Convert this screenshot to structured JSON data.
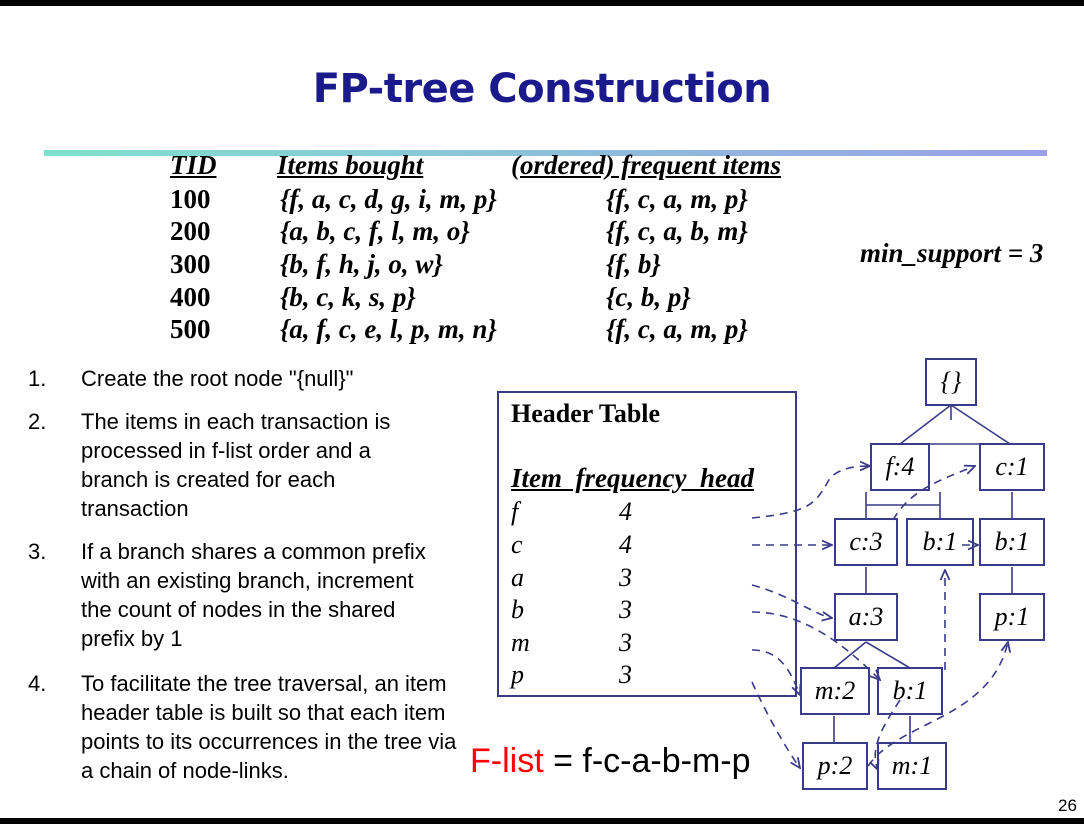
{
  "title": "FP-tree Construction",
  "table": {
    "headers": [
      "TID",
      "Items bought",
      "(ordered) frequent items"
    ],
    "rows": [
      {
        "tid": "100",
        "items": "{f, a, c, d, g, i, m, p}",
        "ordered": "{f, c, a, m, p}"
      },
      {
        "tid": "200",
        "items": "{a, b, c, f, l, m, o}",
        "ordered": "{f, c, a, b, m}"
      },
      {
        "tid": "300",
        "items": "{b, f, h, j, o, w}",
        "ordered": "{f, b}"
      },
      {
        "tid": "400",
        "items": "{b, c, k, s, p}",
        "ordered": "{c, b, p}"
      },
      {
        "tid": "500",
        "items": "{a, f, c, e, l, p, m, n}",
        "ordered": "{f, c, a, m, p}"
      }
    ]
  },
  "min_support": "min_support = 3",
  "steps": [
    {
      "num": "1.",
      "text": "Create the root node \"{null}\""
    },
    {
      "num": "2.",
      "text": "The items in each transaction is processed in f-list order and a branch is created for each transaction"
    },
    {
      "num": "3.",
      "text": "If a branch shares a common prefix with an existing branch, increment the count of nodes in the shared prefix by 1"
    },
    {
      "num": "4.",
      "text": "To facilitate the tree traversal, an item header table is built so that each item points to its occurrences in the tree via a chain of node-links."
    }
  ],
  "header_table": {
    "title": "Header Table",
    "columns": "Item  frequency  head",
    "rows": [
      {
        "item": "f",
        "freq": "4"
      },
      {
        "item": "c",
        "freq": "4"
      },
      {
        "item": "a",
        "freq": "3"
      },
      {
        "item": "b",
        "freq": "3"
      },
      {
        "item": "m",
        "freq": "3"
      },
      {
        "item": "p",
        "freq": "3"
      }
    ]
  },
  "tree": {
    "root": "{}",
    "nodes": {
      "f4": "f:4",
      "c1": "c:1",
      "c3": "c:3",
      "b1a": "b:1",
      "b1b": "b:1",
      "a3": "a:3",
      "p1": "p:1",
      "m2": "m:2",
      "b1c": "b:1",
      "p2": "p:2",
      "m1": "m:1"
    }
  },
  "flist": {
    "label": "F-list",
    "value": "= f-c-a-b-m-p"
  },
  "page_number": "26"
}
